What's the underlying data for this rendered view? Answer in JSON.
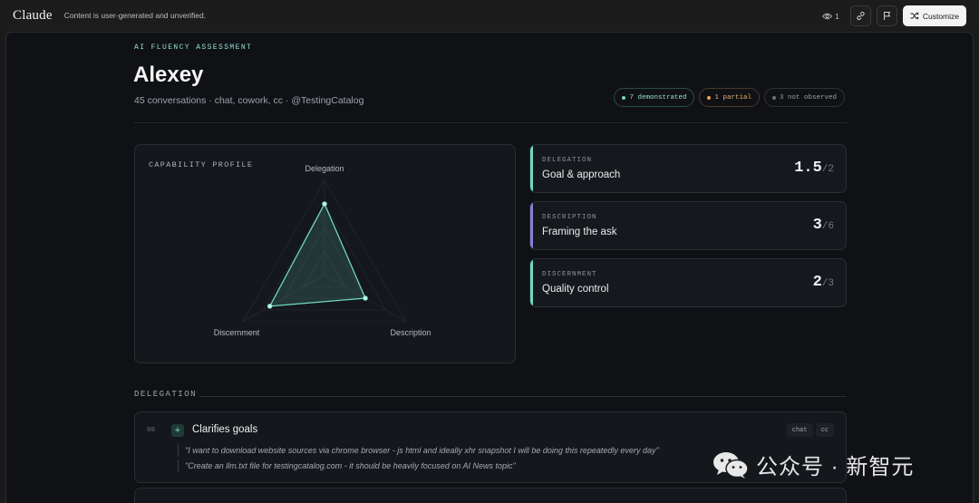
{
  "topbar": {
    "brand": "Claude",
    "notice": "Content is user-generated and unverified.",
    "view_count": "1",
    "customize_label": "Customize"
  },
  "header": {
    "eyebrow": "AI FLUENCY ASSESSMENT",
    "name": "Alexey",
    "subline": "45 conversations · chat, cowork, cc · @TestingCatalog"
  },
  "status_pills": [
    {
      "label": "7 demonstrated",
      "color": "#6fd8c2"
    },
    {
      "label": "1 partial",
      "color": "#e5a85a"
    },
    {
      "label": "3 not observed",
      "color": "#6c7178"
    }
  ],
  "capability_profile": {
    "title": "CAPABILITY PROFILE"
  },
  "chart_data": {
    "type": "radar",
    "axes": [
      "Delegation",
      "Description",
      "Discernment"
    ],
    "values": [
      0.75,
      0.5,
      0.67
    ],
    "range": [
      0,
      1
    ],
    "color": "#6fd8c2"
  },
  "scores": [
    {
      "category": "DELEGATION",
      "label": "Goal & approach",
      "score": "1.5",
      "max": "/2",
      "color": "#6fd8c2"
    },
    {
      "category": "DESCRIPTION",
      "label": "Framing the ask",
      "score": "3",
      "max": "/6",
      "color": "#8b7fd6"
    },
    {
      "category": "DISCERNMENT",
      "label": "Quality control",
      "score": "2",
      "max": "/3",
      "color": "#6fd8c2"
    }
  ],
  "delegation_section": {
    "heading": "DELEGATION",
    "items": [
      {
        "index": "00",
        "title": "Clarifies goals",
        "tags": [
          "chat",
          "cc"
        ],
        "quotes": [
          "\"I want to download website sources via chrome browser - js html and ideally xhr snapshot I will be doing this repeatedly every day\"",
          "\"Create an llm.txt file for testingcatalog.com - it should be heavily focused on AI News topic\""
        ]
      }
    ]
  },
  "watermark": {
    "text": "公众号 · 新智元"
  }
}
